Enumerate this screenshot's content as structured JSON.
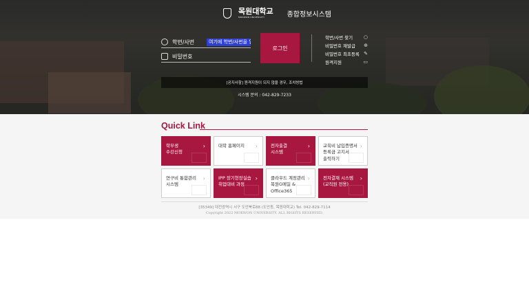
{
  "brand": {
    "university": "목원대학교",
    "university_sub": "MOKWON UNIVERSITY",
    "system_title": "종합정보시스템"
  },
  "login": {
    "id_label": "학번/사번",
    "id_placeholder": "여기에 학번/사번을 입력",
    "pw_label": "비밀번호",
    "button": "로그인"
  },
  "side_links": [
    {
      "label": "학번/사번 찾기",
      "icon": "search-icon"
    },
    {
      "label": "비밀번호 재발급",
      "icon": "plus-circle-icon"
    },
    {
      "label": "비밀번호 최초등록",
      "icon": "wrench-icon"
    },
    {
      "label": "원격지원",
      "icon": "monitor-icon"
    }
  ],
  "notice": "[공지사항] 원격지원이 되지 않을 경우, 조치방법",
  "contact": "시스템 문의 : 042-829-7233",
  "quick_link": {
    "title": "Quick Link",
    "tiles": [
      {
        "label": "학부생\n수강신청",
        "style": "red"
      },
      {
        "label": "대학 홈페이지",
        "style": "white"
      },
      {
        "label": "전자출결\n시스템",
        "style": "red"
      },
      {
        "label": "교육비 납입증명서\n등록금 고지서\n출력하기",
        "style": "white"
      },
      {
        "label": "연구비 통합관리\n시스템",
        "style": "white"
      },
      {
        "label": "IPP 장기현장실습\n취업대비 과정",
        "style": "red"
      },
      {
        "label": "클라우드 계정관리\n목원G메일 &\nOffice365",
        "style": "white"
      },
      {
        "label": "전자결재 시스템\n(교직원 전용)",
        "style": "red"
      }
    ]
  },
  "footer": {
    "address": "[35349] 대전광역시 서구 도안북로88 (도안동, 목원대학교) Tel. 042-829-7114",
    "copyright": "Copyright 2022 MOKWON UNIVERSITY. ALL RIGHTS RESERVED."
  },
  "colors": {
    "accent": "#a8173f",
    "input_highlight": "#2e3fd6"
  }
}
